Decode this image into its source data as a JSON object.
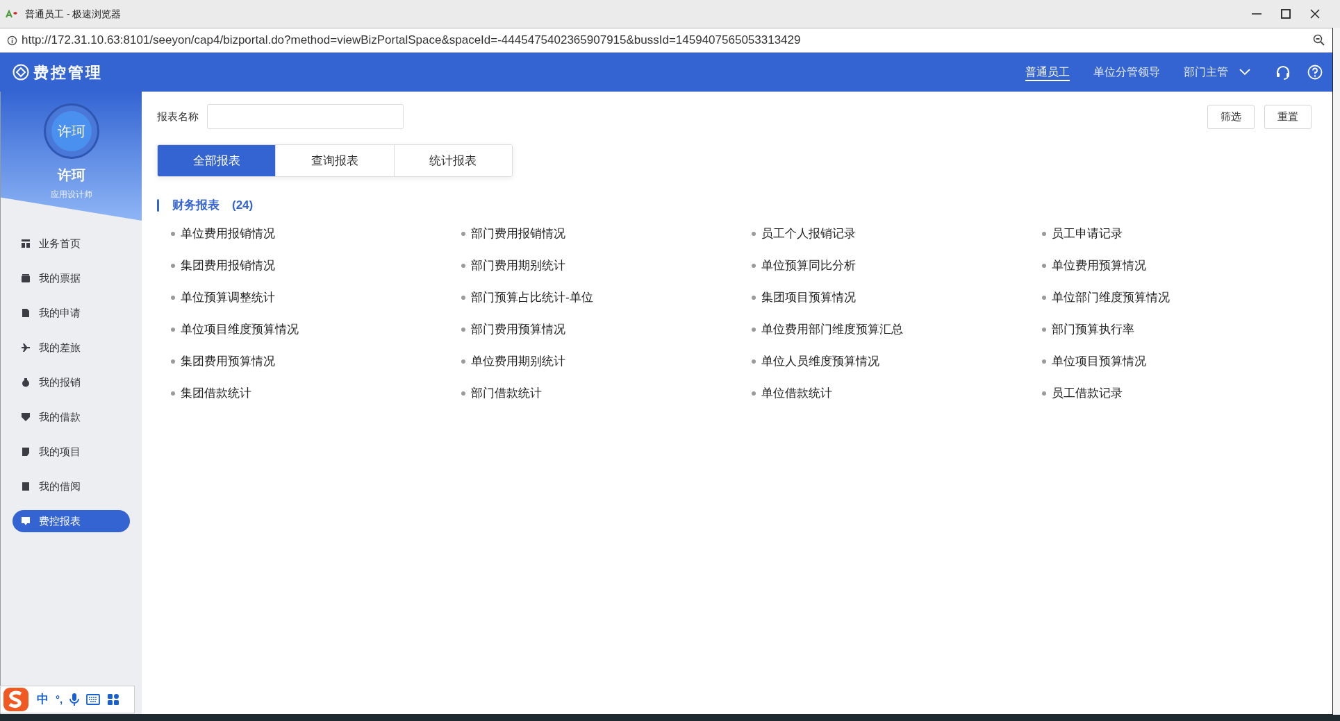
{
  "window": {
    "title": "普通员工 - 极速浏览器"
  },
  "address_bar": {
    "url": "http://172.31.10.63:8101/seeyon/cap4/bizportal.do?method=viewBizPortalSpace&spaceId=-4445475402365907915&bussId=1459407565053313429"
  },
  "header": {
    "app_title": "费控管理",
    "roles": [
      {
        "label": "普通员工",
        "selected": true
      },
      {
        "label": "单位分管领导",
        "selected": false
      },
      {
        "label": "部门主管",
        "selected": false
      }
    ]
  },
  "profile": {
    "avatar_text": "许珂",
    "name": "许珂",
    "role": "应用设计师"
  },
  "sidebar": {
    "items": [
      {
        "label": "业务首页",
        "selected": false
      },
      {
        "label": "我的票据",
        "selected": false
      },
      {
        "label": "我的申请",
        "selected": false
      },
      {
        "label": "我的差旅",
        "selected": false
      },
      {
        "label": "我的报销",
        "selected": false
      },
      {
        "label": "我的借款",
        "selected": false
      },
      {
        "label": "我的项目",
        "selected": false
      },
      {
        "label": "我的借阅",
        "selected": false
      },
      {
        "label": "费控报表",
        "selected": true
      }
    ]
  },
  "filter": {
    "label": "报表名称",
    "buttons": [
      "筛选",
      "重置"
    ]
  },
  "tabs": [
    {
      "label": "全部报表",
      "selected": true
    },
    {
      "label": "查询报表",
      "selected": false
    },
    {
      "label": "统计报表",
      "selected": false
    }
  ],
  "section": {
    "title": "财务报表",
    "count": "(24)",
    "reports": [
      "单位费用报销情况",
      "部门费用报销情况",
      "员工个人报销记录",
      "员工申请记录",
      "集团费用报销情况",
      "部门费用期别统计",
      "单位预算同比分析",
      "单位费用预算情况",
      "单位预算调整统计",
      "部门预算占比统计-单位",
      "集团项目预算情况",
      "单位部门维度预算情况",
      "单位项目维度预算情况",
      "部门费用预算情况",
      "单位费用部门维度预算汇总",
      "部门预算执行率",
      "集团费用预算情况",
      "单位费用期别统计",
      "单位人员维度预算情况",
      "单位项目预算情况",
      "集团借款统计",
      "部门借款统计",
      "单位借款统计",
      "员工借款记录"
    ]
  },
  "ime_toolbar": {
    "labels": [
      "中",
      "°,"
    ]
  }
}
